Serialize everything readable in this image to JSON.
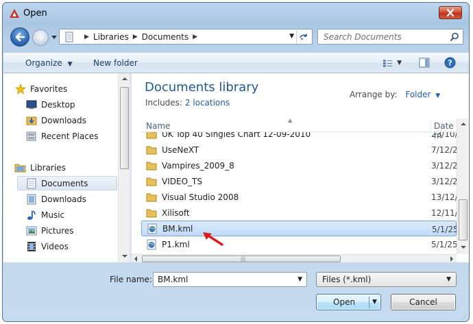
{
  "window": {
    "title": "Open",
    "close_icon": "close-icon"
  },
  "address": {
    "crumbs": [
      "Libraries",
      "Documents"
    ],
    "search_placeholder": "Search Documents"
  },
  "toolbar": {
    "organize_label": "Organize",
    "new_folder_label": "New folder"
  },
  "nav": {
    "favorites": "Favorites",
    "desktop": "Desktop",
    "downloads_fav": "Downloads",
    "recent_places": "Recent Places",
    "libraries": "Libraries",
    "documents": "Documents",
    "downloads_lib": "Downloads",
    "music": "Music",
    "pictures": "Pictures",
    "videos": "Videos"
  },
  "library": {
    "title": "Documents library",
    "includes_label": "Includes:",
    "locations_link": "2 locations",
    "arrange_label": "Arrange by:",
    "arrange_value": "Folder"
  },
  "columns": {
    "name": "Name",
    "date": "Date m"
  },
  "files": [
    {
      "name": "UK Top 40 Singles Chart 12-09-2010",
      "date": "23/10/",
      "type": "folder"
    },
    {
      "name": "UseNeXT",
      "date": "7/12/2",
      "type": "folder"
    },
    {
      "name": "Vampires_2009_8",
      "date": "3/12/2",
      "type": "folder"
    },
    {
      "name": "VIDEO_TS",
      "date": "3/12/2",
      "type": "folder"
    },
    {
      "name": "Visual Studio 2008",
      "date": "13/12/",
      "type": "folder"
    },
    {
      "name": "Xilisoft",
      "date": "12/11/",
      "type": "folder"
    },
    {
      "name": "BM.kml",
      "date": "5/1/25",
      "type": "kml"
    },
    {
      "name": "P1.kml",
      "date": "5/1/25",
      "type": "kml"
    }
  ],
  "bottom": {
    "file_name_label": "File name:",
    "file_name_value": "BM.kml",
    "file_type_value": "Files (*.kml)",
    "open_label": "Open",
    "cancel_label": "Cancel"
  }
}
